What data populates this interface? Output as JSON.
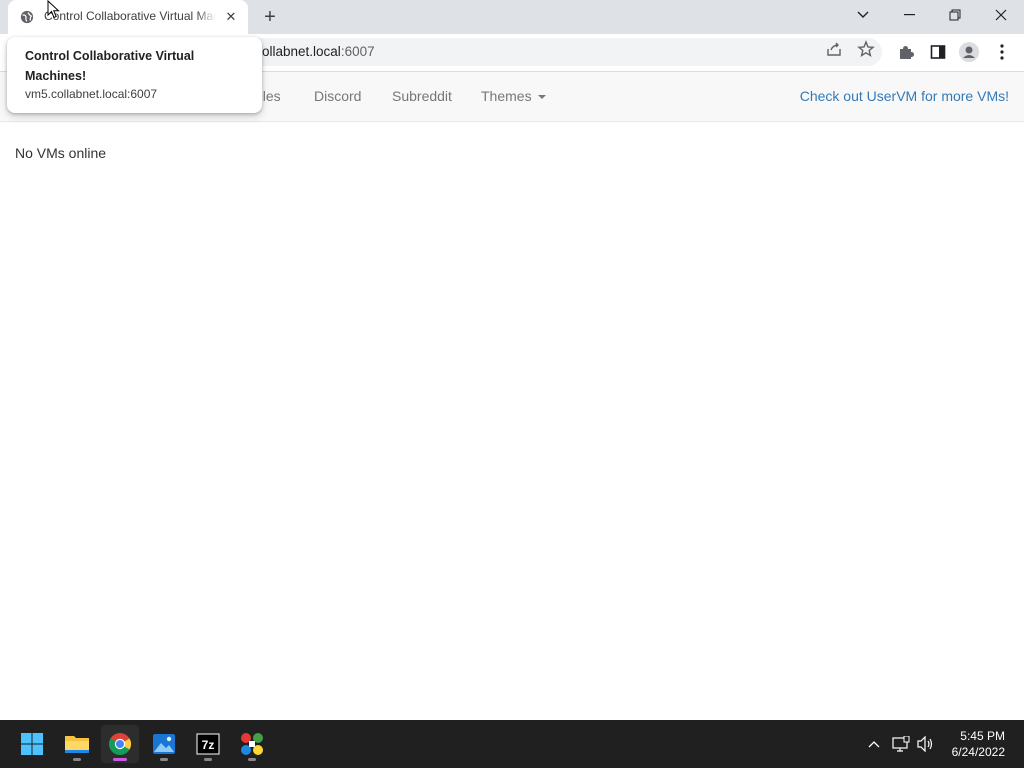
{
  "browser": {
    "tab": {
      "title": "Control Collaborative Virtual Machines!",
      "favicon": "globe-icon",
      "close_icon": "close-icon"
    },
    "new_tab_icon": "plus-icon",
    "window_controls": [
      "chevron-down-icon",
      "minimize-icon",
      "restore-icon",
      "close-icon"
    ],
    "address_bar": {
      "visible_text_host": "ollabnet.local",
      "visible_text_rest": ":6007"
    },
    "toolbar_icons": [
      "share-icon",
      "star-icon",
      "extensions-icon",
      "side-panel-icon",
      "profile-icon",
      "menu-icon"
    ]
  },
  "hovercard": {
    "title": "Control Collaborative Virtual Machines!",
    "url": "vm5.collabnet.local:6007"
  },
  "navbar": {
    "rules_partial": "ules",
    "discord": "Discord",
    "subreddit": "Subreddit",
    "themes": "Themes",
    "right_link": "Check out UserVM for more VMs!",
    "link_color": "#337ab7"
  },
  "main": {
    "status": "No VMs online"
  },
  "taskbar": {
    "apps": [
      "windows-start-icon",
      "file-explorer-icon",
      "chrome-icon",
      "photos-icon",
      "7zip-icon",
      "game-icon"
    ],
    "tray_icons": [
      "chevron-up-icon",
      "network-icon",
      "volume-icon"
    ],
    "time": "5:45 PM",
    "date": "6/24/2022"
  }
}
